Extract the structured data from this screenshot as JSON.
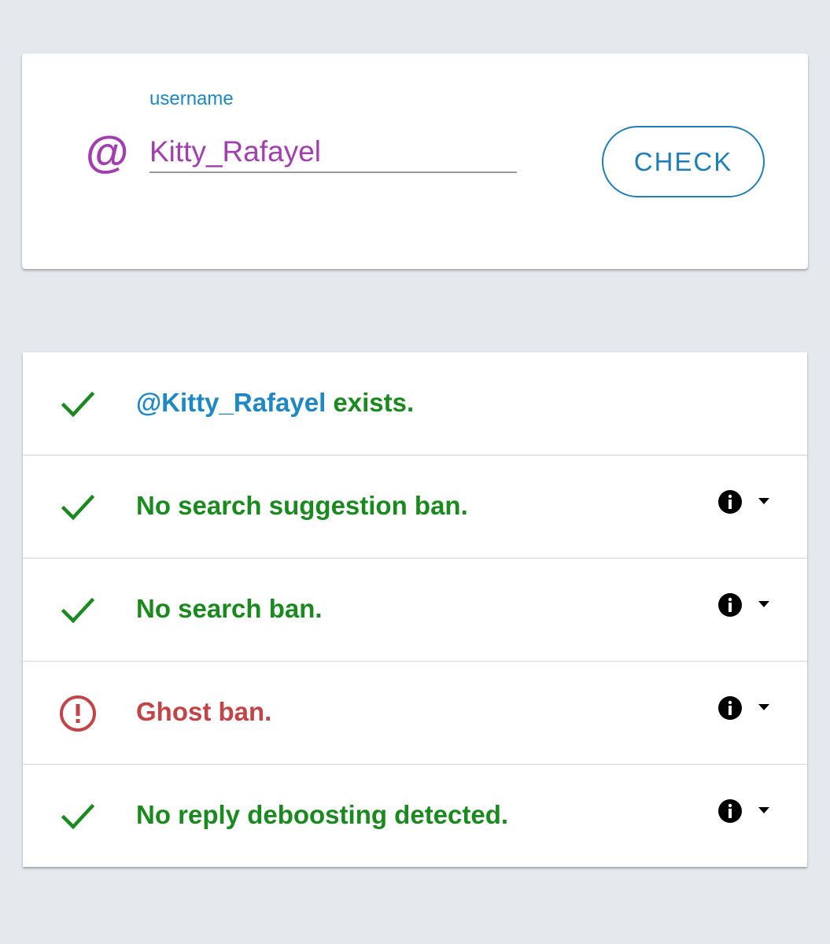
{
  "search": {
    "label": "username",
    "value": "Kitty_Rafayel",
    "prefix_icon": "at-icon",
    "button_label": "CHECK"
  },
  "results": [
    {
      "status": "ok",
      "icon": "check-icon",
      "username": "@Kitty_Rafayel",
      "text": " exists.",
      "has_info": false
    },
    {
      "status": "ok",
      "icon": "check-icon",
      "text": "No search suggestion ban.",
      "has_info": true
    },
    {
      "status": "ok",
      "icon": "check-icon",
      "text": "No search ban.",
      "has_info": true
    },
    {
      "status": "ban",
      "icon": "alert-circle-icon",
      "text": "Ghost ban.",
      "has_info": true
    },
    {
      "status": "ok",
      "icon": "check-icon",
      "text": "No reply deboosting detected.",
      "has_info": true
    }
  ],
  "colors": {
    "background": "#e5e9ed",
    "accent_purple": "#a23fb0",
    "accent_blue": "#1e88c2",
    "ok_green": "#1a8a1f",
    "ban_red": "#c24446"
  }
}
